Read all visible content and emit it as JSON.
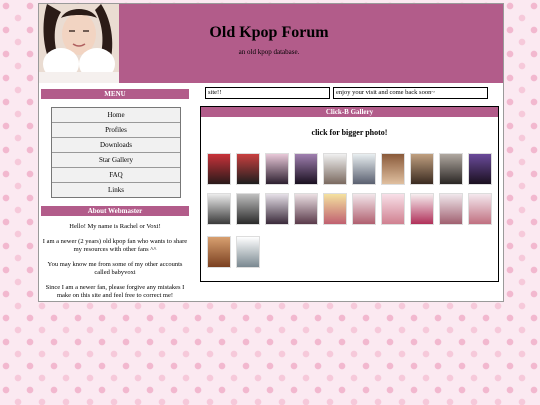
{
  "header": {
    "title": "Old Kpop Forum",
    "subtitle": "an old kpop database."
  },
  "sidebar": {
    "menu_title": "MENU",
    "items": [
      {
        "label": "Home"
      },
      {
        "label": "Profiles"
      },
      {
        "label": "Downloads"
      },
      {
        "label": "Star Gallery"
      },
      {
        "label": "FAQ"
      },
      {
        "label": "Links"
      }
    ],
    "about_title": "About Webmaster",
    "about_paragraphs": [
      "Hello! My name is Rachel or Voxi!",
      "I am a newer (2 years) old kpop fan who wants to share my resources with other fans ^^",
      "You may know me from some of my other accounts called babyvoxi",
      "Since I am a newer fan, please forgive any mistakes I make on this site and feel free to correct me!"
    ]
  },
  "top_boxes": {
    "left": "site!!",
    "right": "enjoy your visit and come back soon~"
  },
  "gallery": {
    "title": "Click-B Gallery",
    "subtitle": "click for bigger photo!",
    "thumb_count": 22
  },
  "colors": {
    "accent": "#b25c8a",
    "background_pink": "#fbe9f1"
  }
}
